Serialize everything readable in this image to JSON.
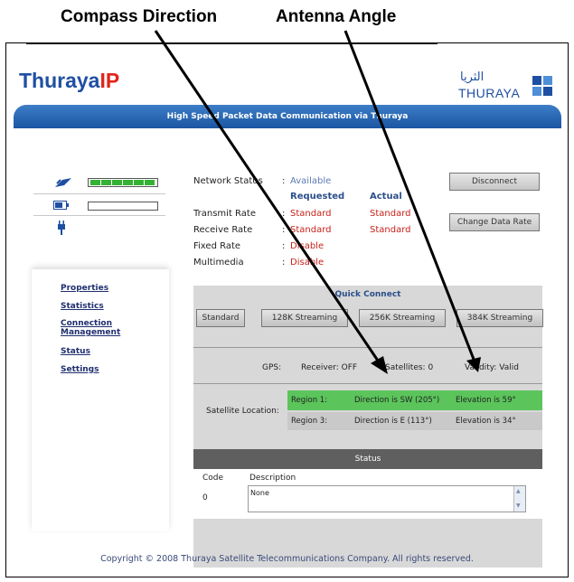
{
  "callouts": {
    "compass": "Compass Direction",
    "antenna": "Antenna Angle"
  },
  "logo": {
    "left_main": "Thuraya",
    "left_accent": "IP",
    "right_arabic": "الثريا",
    "right_english": "THURAYA"
  },
  "banner": {
    "text": "High Speed Packet Data Communication via Thuraya"
  },
  "signal": {
    "level": 6,
    "max": 6
  },
  "menu": {
    "items": [
      {
        "label": "Properties"
      },
      {
        "label": "Statistics"
      },
      {
        "label": "Connection Management"
      },
      {
        "label": "Status"
      },
      {
        "label": "Settings"
      }
    ]
  },
  "network": {
    "status_label": "Network Status",
    "status_value": "Available",
    "requested_header": "Requested",
    "actual_header": "Actual",
    "rows": [
      {
        "label": "Transmit Rate",
        "requested": "Standard",
        "actual": "Standard"
      },
      {
        "label": "Receive Rate",
        "requested": "Standard",
        "actual": "Standard"
      },
      {
        "label": "Fixed Rate",
        "requested": "Disable",
        "actual": ""
      },
      {
        "label": "Multimedia",
        "requested": "Disable",
        "actual": ""
      }
    ]
  },
  "buttons": {
    "disconnect": "Disconnect",
    "change_rate": "Change Data Rate"
  },
  "quick_connect": {
    "title": "Quick Connect",
    "options": [
      "Standard",
      "128K Streaming",
      "256K Streaming",
      "384K Streaming"
    ]
  },
  "gps": {
    "label": "GPS:",
    "receiver": "Receiver: OFF",
    "satellites": "Satellites: 0",
    "validity": "Validity: Valid"
  },
  "satellite": {
    "label": "Satellite Location:",
    "rows": [
      {
        "region": "Region 1:",
        "direction": "Direction is  SW (205°)",
        "elevation": "Elevation is  59°"
      },
      {
        "region": "Region 3:",
        "direction": "Direction is  E (113°)",
        "elevation": "Elevation is  34°"
      }
    ]
  },
  "status": {
    "title": "Status",
    "code_header": "Code",
    "desc_header": "Description",
    "code": "0",
    "description": "None"
  },
  "footer": {
    "copyright": "Copyright © 2008 Thuraya Satellite Telecommunications Company. All rights reserved."
  },
  "colors": {
    "brand_blue": "#1f4fa2",
    "accent_red": "#e0251b",
    "selected_row": "#5bc45b",
    "signal_green": "#33b233"
  }
}
